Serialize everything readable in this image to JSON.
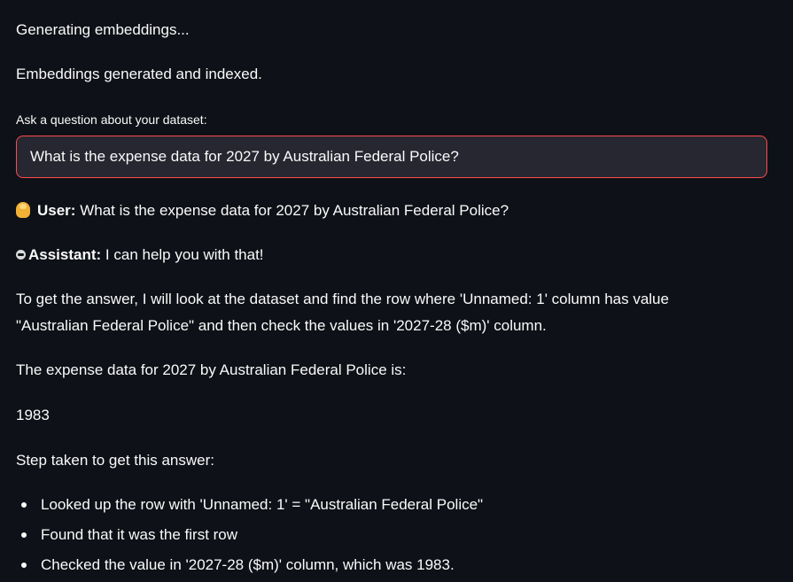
{
  "status": {
    "generating": "Generating embeddings...",
    "done": "Embeddings generated and indexed."
  },
  "question_input": {
    "label": "Ask a question about your dataset:",
    "value": "What is the expense data for 2027 by Australian Federal Police?"
  },
  "chat": {
    "user": {
      "icon": "user-avatar-icon",
      "speaker": "User:",
      "message": "What is the expense data for 2027 by Australian Federal Police?"
    },
    "assistant": {
      "icon": "robot-icon",
      "speaker": "Assistant:",
      "intro": "I can help you with that!",
      "paragraph_1_line_1": "To get the answer, I will look at the dataset and find the row where 'Unnamed: 1' column has value",
      "paragraph_1_line_2": "\"Australian Federal Police\" and then check the values in '2027-28 ($m)' column.",
      "result_label": "The expense data for 2027 by Australian Federal Police is:",
      "result_value": "1983",
      "steps_heading": "Step taken to get this answer:",
      "steps": [
        "Looked up the row with 'Unnamed: 1' = \"Australian Federal Police\"",
        "Found that it was the first row",
        "Checked the value in '2027-28 ($m)' column, which was 1983."
      ]
    }
  },
  "colors": {
    "background": "#0e1117",
    "input_background": "#262730",
    "input_focus_border": "#ff4b4b",
    "text": "#fafafa"
  }
}
